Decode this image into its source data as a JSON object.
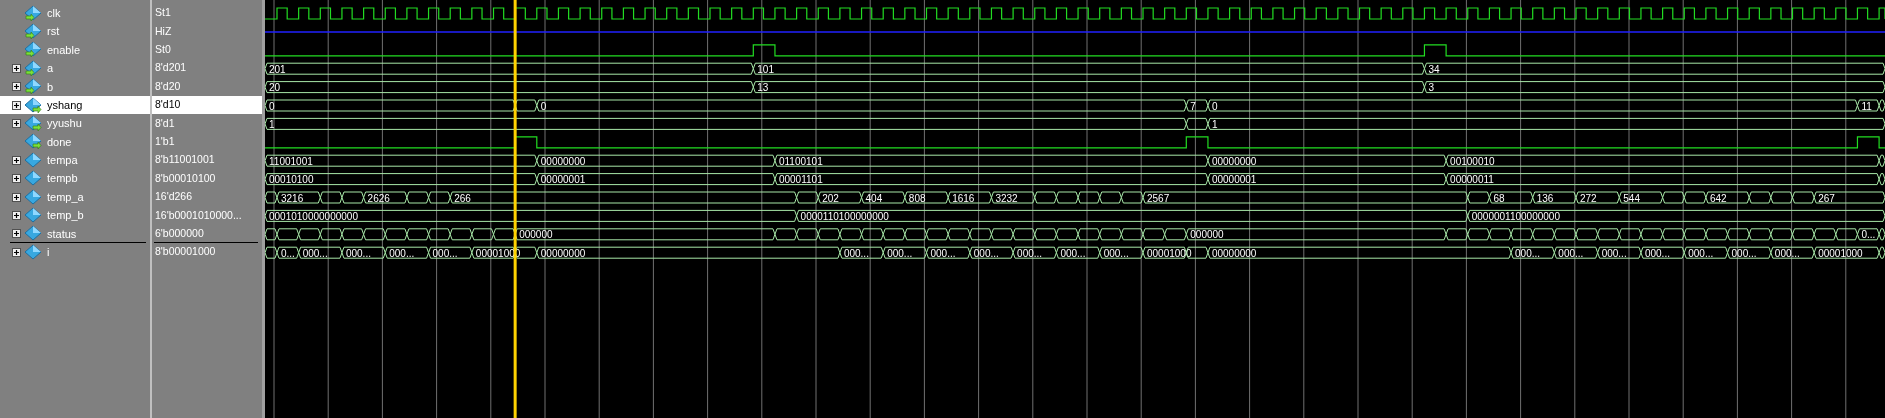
{
  "signals": [
    {
      "name": "clk",
      "value": "St1",
      "expandable": false,
      "selected": false,
      "input": true,
      "output": false,
      "kind": "clock"
    },
    {
      "name": "rst",
      "value": "HiZ",
      "expandable": false,
      "selected": false,
      "input": true,
      "output": false,
      "kind": "hiz"
    },
    {
      "name": "enable",
      "value": "St0",
      "expandable": false,
      "selected": false,
      "input": true,
      "output": false,
      "kind": "bit"
    },
    {
      "name": "a",
      "value": "8'd201",
      "expandable": true,
      "selected": false,
      "input": true,
      "output": false,
      "kind": "bus",
      "labels": [
        "201",
        "101",
        "34"
      ]
    },
    {
      "name": "b",
      "value": "8'd20",
      "expandable": true,
      "selected": false,
      "input": true,
      "output": false,
      "kind": "bus",
      "labels": [
        "20",
        "13",
        "3"
      ]
    },
    {
      "name": "yshang",
      "value": "8'd10",
      "expandable": true,
      "selected": true,
      "input": false,
      "output": true,
      "kind": "bus",
      "labels": [
        "0",
        "0",
        "7",
        "0",
        "11"
      ]
    },
    {
      "name": "yyushu",
      "value": "8'd1",
      "expandable": true,
      "selected": false,
      "input": false,
      "output": true,
      "kind": "bus",
      "labels": [
        "1",
        "1"
      ]
    },
    {
      "name": "done",
      "value": "1'b1",
      "expandable": false,
      "selected": false,
      "input": false,
      "output": true,
      "kind": "bit"
    },
    {
      "name": "tempa",
      "value": "8'b11001001",
      "expandable": true,
      "selected": false,
      "input": false,
      "output": false,
      "kind": "bus",
      "labels": [
        "11001001",
        "00000000",
        "01100101",
        "00000000",
        "00100010"
      ]
    },
    {
      "name": "tempb",
      "value": "8'b00010100",
      "expandable": true,
      "selected": false,
      "input": false,
      "output": false,
      "kind": "bus",
      "labels": [
        "00010100",
        "00000001",
        "00001101",
        "00000001",
        "00000011"
      ]
    },
    {
      "name": "temp_a",
      "value": "16'd266",
      "expandable": true,
      "selected": false,
      "input": false,
      "output": false,
      "kind": "bus",
      "labels": [
        "3216",
        "2626",
        "266",
        "202",
        "404",
        "808",
        "1616",
        "3232",
        "2567",
        "68",
        "136",
        "272",
        "544",
        "642",
        "267"
      ]
    },
    {
      "name": "temp_b",
      "value": "16'b0001010000...",
      "expandable": true,
      "selected": false,
      "input": false,
      "output": false,
      "kind": "bus",
      "labels": [
        "0001010000000000",
        "0000110100000000",
        "0000001100000000"
      ]
    },
    {
      "name": "status",
      "value": "6'b000000",
      "expandable": true,
      "selected": false,
      "input": false,
      "output": false,
      "kind": "bus",
      "labels": [
        "000000",
        "000000",
        "0..."
      ]
    },
    {
      "name": "i",
      "value": "8'b00001000",
      "expandable": true,
      "selected": false,
      "input": false,
      "output": false,
      "kind": "bus",
      "labels": [
        "0...",
        "000...",
        "000...",
        "000...",
        "000...",
        "00001000",
        "00000000",
        "000...",
        "000...",
        "000...",
        "000...",
        "000...",
        "000...",
        "000...",
        "00001000",
        "00000000",
        "000...",
        "000...",
        "000...",
        "000...",
        "000...",
        "000...",
        "000...",
        "00001000"
      ]
    }
  ]
}
